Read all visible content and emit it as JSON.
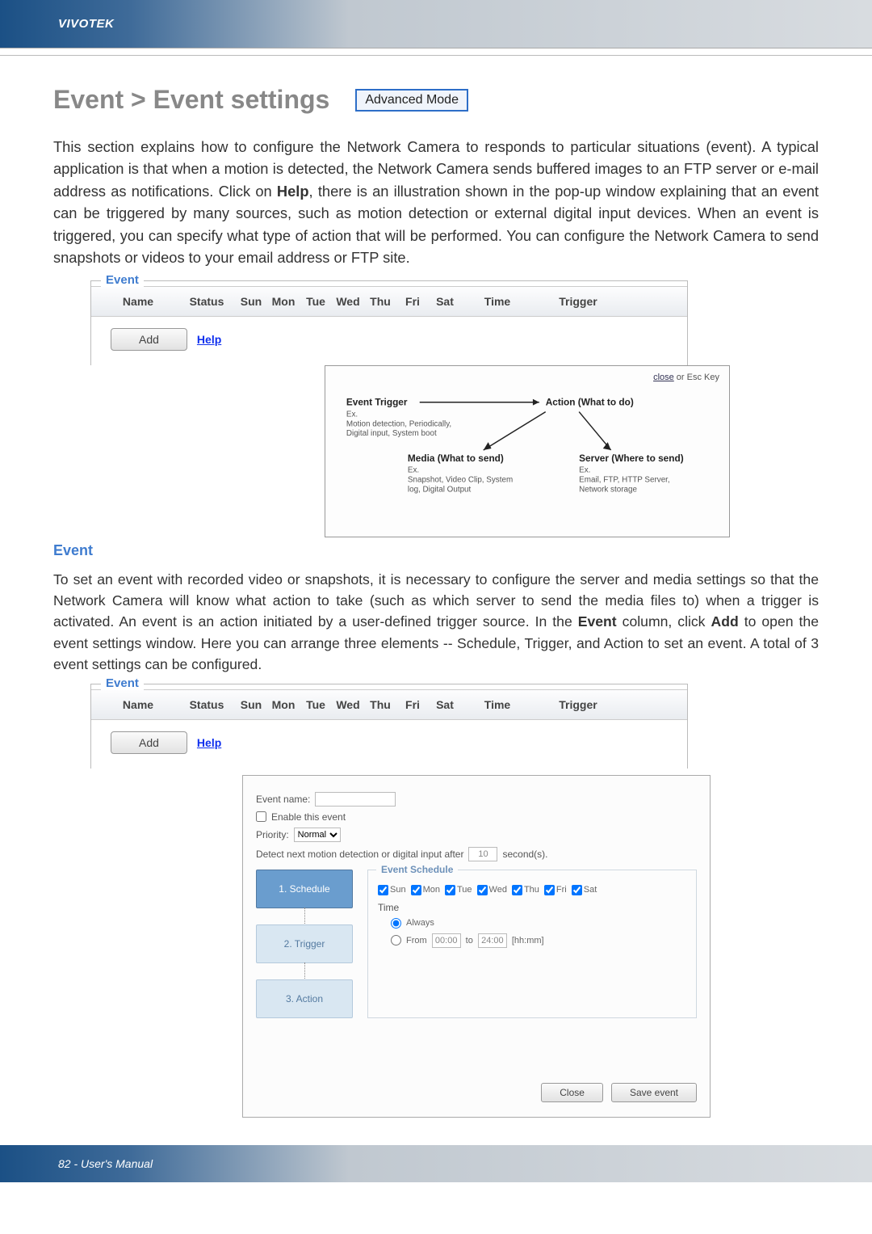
{
  "brand": "VIVOTEK",
  "title": "Event > Event settings",
  "mode_badge": "Advanced Mode",
  "intro": "This section explains how to configure the Network Camera to responds to particular situations (event). A typical application is that when a motion is detected, the Network Camera sends buffered images to an FTP server or e-mail address as notifications. Click on ",
  "intro_help_word": "Help",
  "intro_after": ", there is an illustration shown in the pop-up window explaining that an event can be triggered by many sources, such as motion detection or external digital input devices. When an event is triggered, you can specify what type of action that will be performed. You can configure the Network Camera to send snapshots or videos to your email address or FTP site.",
  "event_box": {
    "legend": "Event",
    "cols": [
      "Name",
      "Status",
      "Sun",
      "Mon",
      "Tue",
      "Wed",
      "Thu",
      "Fri",
      "Sat",
      "Time",
      "Trigger"
    ],
    "add_btn": "Add",
    "help_link": "Help"
  },
  "diagram": {
    "close": "close",
    "close_suffix": " or Esc Key",
    "trigger_title": "Event Trigger",
    "trigger_ex": "Ex.",
    "trigger_detail": "Motion detection, Periodically, Digital input, System boot",
    "action_title": "Action (What to do)",
    "media_title": "Media (What to send)",
    "media_ex": "Ex.",
    "media_detail": "Snapshot, Video Clip, System log, Digital Output",
    "server_title": "Server (Where to send)",
    "server_ex": "Ex.",
    "server_detail": "Email, FTP, HTTP Server, Network storage"
  },
  "section2_hdr": "Event",
  "para2_a": "To set an event with recorded video or snapshots, it is necessary to configure the server and media settings so that the Network Camera will know what action to take (such as which server to send the media files to) when a trigger is activated. An event is an action initiated by a user-defined trigger source. In the ",
  "para2_event_bold": "Event",
  "para2_b": "  column, click ",
  "para2_add_bold": "Add",
  "para2_c": " to open the event settings window. Here you can arrange three elements -- Schedule, Trigger, and Action to set an event. A total of 3 event settings can be configured.",
  "config": {
    "event_name_label": "Event name:",
    "enable_label": "Enable this event",
    "priority_label": "Priority:",
    "priority_value": "Normal",
    "detect_label_a": "Detect next motion detection or digital input after",
    "detect_value": "10",
    "detect_label_b": "second(s).",
    "steps": [
      "1. Schedule",
      "2. Trigger",
      "3. Action"
    ],
    "schedule_legend": "Event Schedule",
    "days": [
      "Sun",
      "Mon",
      "Tue",
      "Wed",
      "Thu",
      "Fri",
      "Sat"
    ],
    "time_label": "Time",
    "always_label": "Always",
    "from_label": "From",
    "from_value": "00:00",
    "to_label": "to",
    "to_value": "24:00",
    "hhmm": "[hh:mm]",
    "close_btn": "Close",
    "save_btn": "Save event"
  },
  "footer": "82 - User's Manual"
}
